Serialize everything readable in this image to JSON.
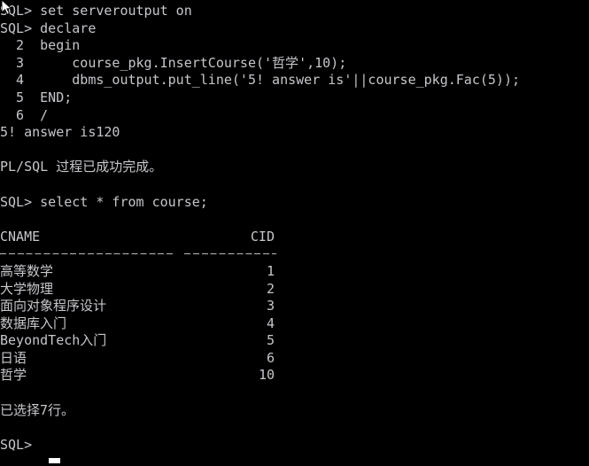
{
  "terminal": {
    "title": "SQL*Plus console",
    "background_color": "#000000",
    "foreground_color": "#c6c6cc",
    "cursor_color": "#ffffff",
    "prompt": "SQL>"
  },
  "lines": {
    "l01": "SQL> set serveroutput on",
    "l02": "SQL> declare",
    "l03": "  2  begin",
    "l04": "  3      course_pkg.InsertCourse('哲学',10);",
    "l05": "  4      dbms_output.put_line('5! answer is'||course_pkg.Fac(5));",
    "l06": "  5  END;",
    "l07": "  6  /",
    "l08": "5! answer is120",
    "l09": "PL/SQL 过程已成功完成。",
    "l10": "SQL> select * from course;",
    "l11": "已选择7行。",
    "l12": "SQL>"
  },
  "code_segments": {
    "line3_prefix": "  3      course_pkg.InsertCourse('",
    "line3_cjk": "哲学",
    "line3_suffix": "',10);",
    "line9_prefix": "PL/SQL ",
    "line9_cjk": "过程已成功完成。",
    "line11_cjk_a": "已选择",
    "line11_num": "7",
    "line11_cjk_b": "行。"
  },
  "result_table": {
    "headers": [
      "CNAME",
      "CID"
    ],
    "separator_cname": "--------------------",
    "separator_cid": "----------",
    "rows": [
      {
        "cname": "高等数学",
        "cid": "1",
        "ascii_lead": false
      },
      {
        "cname": "大学物理",
        "cid": "2",
        "ascii_lead": false
      },
      {
        "cname": "面向对象程序设计",
        "cid": "3",
        "ascii_lead": false
      },
      {
        "cname": "数据库入门",
        "cid": "4",
        "ascii_lead": false
      },
      {
        "cname": "BeyondTech入门",
        "cid": "5",
        "ascii_lead": true
      },
      {
        "cname": "日语",
        "cid": "6",
        "ascii_lead": false
      },
      {
        "cname": "哲学",
        "cid": "10",
        "ascii_lead": false
      }
    ],
    "row_count_message": "已选择7行。"
  }
}
